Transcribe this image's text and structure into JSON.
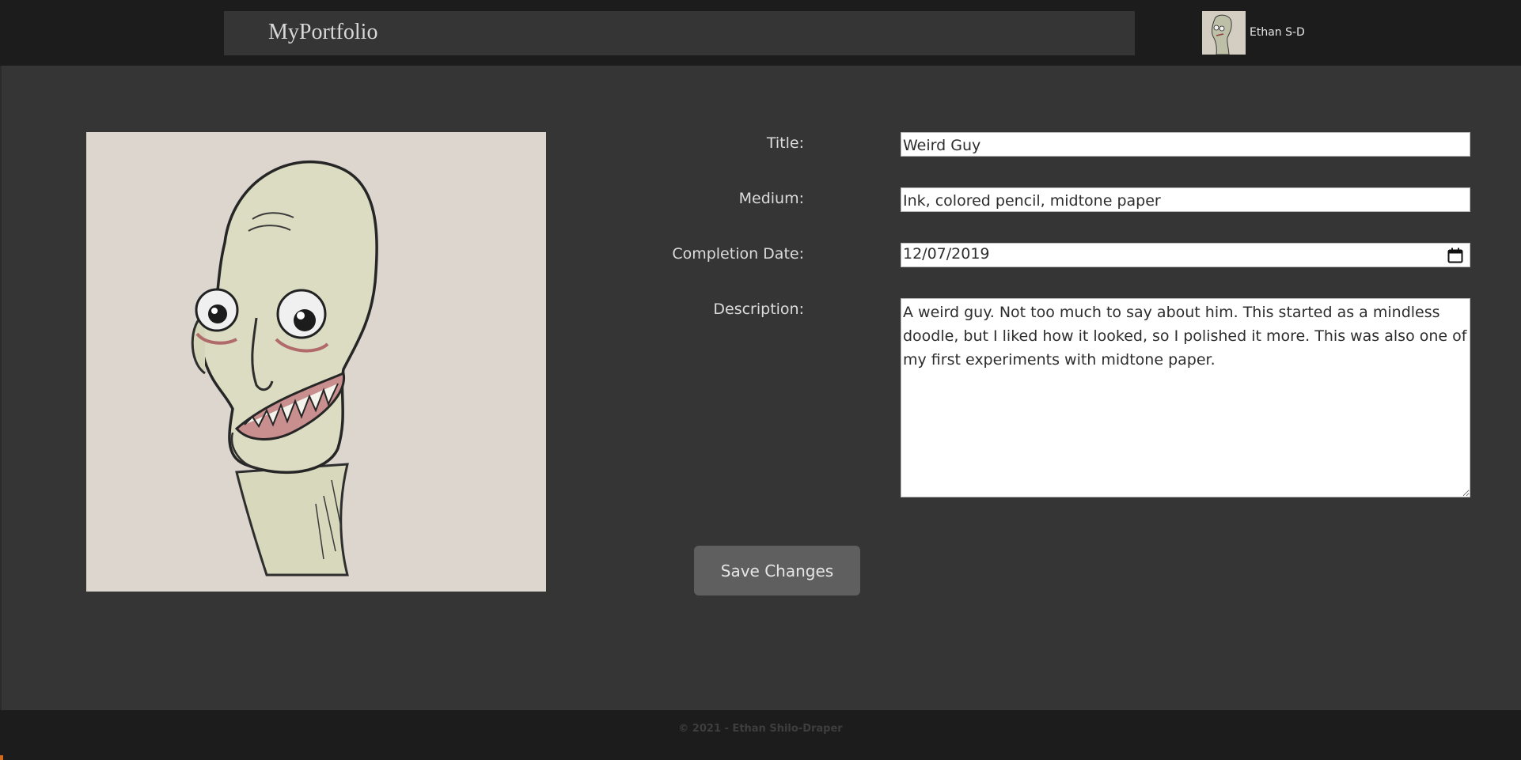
{
  "header": {
    "brand": "MyPortfolio",
    "user": {
      "name": "Ethan S-D",
      "avatar_icon": "sketch-portrait-thumbnail"
    }
  },
  "artwork": {
    "image_icon": "weird-guy-sketch"
  },
  "form": {
    "title": {
      "label": "Title:",
      "value": "Weird Guy"
    },
    "medium": {
      "label": "Medium:",
      "value": "Ink, colored pencil, midtone paper"
    },
    "completion_date": {
      "label": "Completion Date:",
      "value": "12/07/2019",
      "icon": "calendar-icon"
    },
    "description": {
      "label": "Description:",
      "value": "A weird guy. Not too much to say about him. This started as a mindless doodle, but I liked how it looked, so I polished it more. This was also one of my first experiments with midtone paper."
    },
    "save_label": "Save Changes"
  },
  "footer": {
    "copyright": "© 2021 - Ethan Shilo-Draper"
  },
  "colors": {
    "page_background": "#353535",
    "nav_background": "#1c1c1c",
    "button_background": "#5f5f5f",
    "accent": "#d26a1c"
  }
}
